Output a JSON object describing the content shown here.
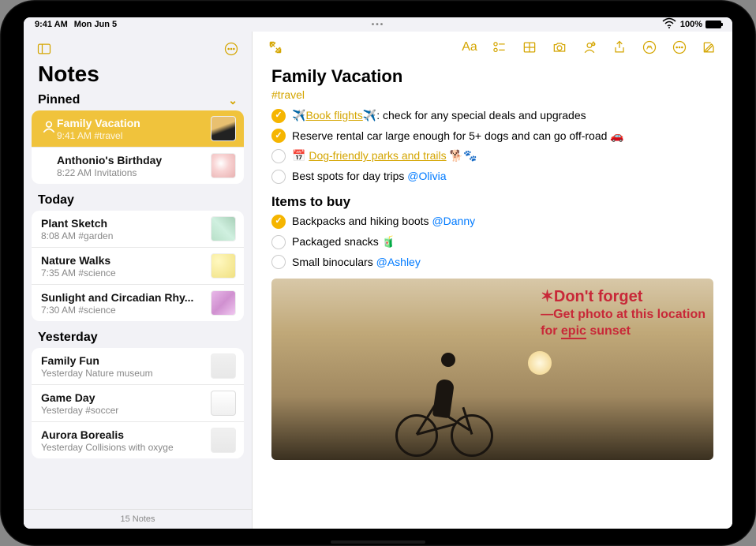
{
  "status": {
    "time": "9:41 AM",
    "date": "Mon Jun 5",
    "battery_pct": "100%"
  },
  "sidebar": {
    "title": "Notes",
    "footer": "15 Notes",
    "sections": [
      {
        "header": "Pinned",
        "items": [
          {
            "title": "Family Vacation",
            "meta": "9:41 AM  #travel",
            "selected": true,
            "shared": true,
            "thumb": "art1"
          },
          {
            "title": "Anthonio's Birthday",
            "meta": "8:22 AM  Invitations",
            "thumb": "art2"
          }
        ]
      },
      {
        "header": "Today",
        "items": [
          {
            "title": "Plant Sketch",
            "meta": "8:08 AM  #garden",
            "thumb": "art3"
          },
          {
            "title": "Nature Walks",
            "meta": "7:35 AM  #science",
            "thumb": "art4"
          },
          {
            "title": "Sunlight and Circadian Rhy...",
            "meta": "7:30 AM  #science",
            "thumb": "art5"
          }
        ]
      },
      {
        "header": "Yesterday",
        "items": [
          {
            "title": "Family Fun",
            "meta": "Yesterday  Nature museum",
            "thumb": "art6"
          },
          {
            "title": "Game Day",
            "meta": "Yesterday  #soccer",
            "thumb": "art7"
          },
          {
            "title": "Aurora Borealis",
            "meta": "Yesterday  Collisions with oxyge",
            "thumb": "art6"
          }
        ]
      }
    ]
  },
  "editor": {
    "title": "Family Vacation",
    "tag": "#travel",
    "checklist1": [
      {
        "checked": true,
        "pre_emoji": "✈️",
        "link_text": "Book flights",
        "post_emoji": "✈️",
        "text": ": check for any special deals and upgrades"
      },
      {
        "checked": true,
        "text": "Reserve rental car large enough for 5+ dogs and can go off-road 🚗"
      },
      {
        "checked": false,
        "pre_emoji": "📅 ",
        "link_text": "Dog-friendly parks and trails",
        "post_text": " 🐕🐾"
      },
      {
        "checked": false,
        "text": "Best spots for day trips ",
        "mention": "@Olivia"
      }
    ],
    "subheading": "Items to buy",
    "checklist2": [
      {
        "checked": true,
        "text": "Backpacks and hiking boots ",
        "mention": "@Danny"
      },
      {
        "checked": false,
        "text": "Packaged snacks 🧃"
      },
      {
        "checked": false,
        "text": "Small binoculars ",
        "mention": "@Ashley"
      }
    ],
    "handwriting": {
      "star": "✶",
      "title": "Don't forget",
      "line1": "—Get photo at this location",
      "line2_pre": "for ",
      "line2_em": "epic",
      "line2_post": " sunset"
    }
  }
}
